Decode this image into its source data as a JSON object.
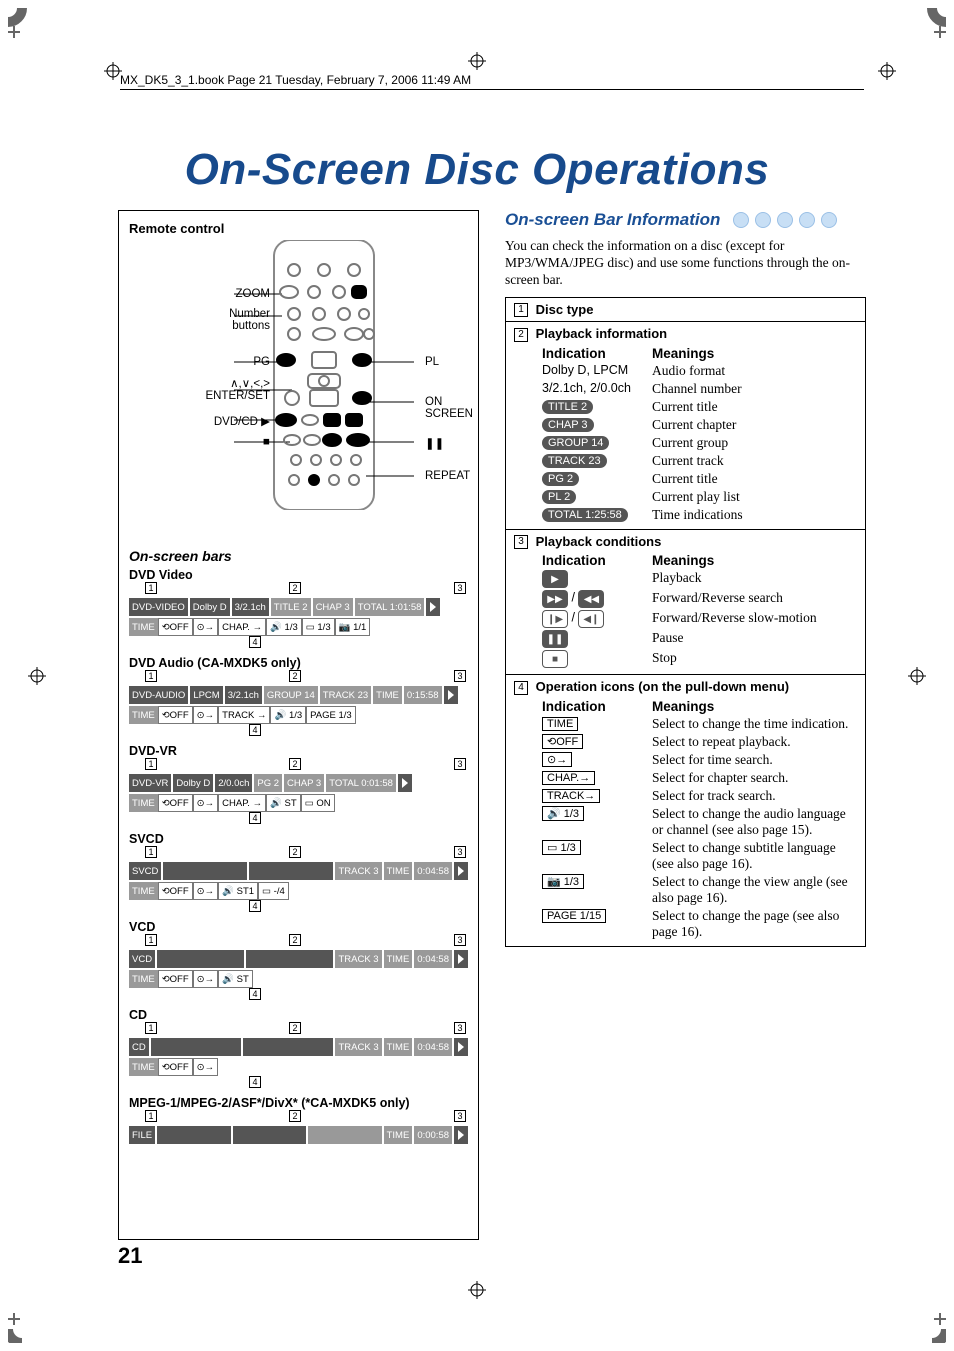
{
  "header_line": "MX_DK5_3_1.book  Page 21  Tuesday, February 7, 2006  11:49 AM",
  "title": "On-Screen Disc Operations",
  "page_number": "21",
  "left": {
    "remote_title": "Remote control",
    "labels": {
      "zoom": "ZOOM",
      "number_buttons_a": "Number",
      "number_buttons_b": "buttons",
      "pg": "PG",
      "arrows_enter": "∧,∨,<,>\nENTER/SET",
      "dvdcd": "DVD/CD ▶",
      "stop": "■",
      "pl": "PL",
      "onscreen": "ON SCREEN",
      "pause": "❚❚",
      "repeat": "REPEAT"
    },
    "bars_heading": "On-screen bars",
    "bars": [
      {
        "name": "DVD Video",
        "row1": [
          "DVD-VIDEO",
          "Dolby D",
          "3/2.1ch",
          "TITLE 2",
          "CHAP 3",
          "TOTAL 1:01:58",
          "▶"
        ],
        "row2": [
          "TIME",
          "⟲OFF",
          "⊙→",
          "CHAP. →",
          "🔊 1/3",
          "▭ 1/3",
          "📷 1/1"
        ]
      },
      {
        "name": "DVD Audio (CA-MXDK5 only)",
        "row1": [
          "DVD-AUDIO",
          "LPCM",
          "3/2.1ch",
          "GROUP 14",
          "TRACK 23",
          "TIME",
          "0:15:58",
          "▶"
        ],
        "row2": [
          "TIME",
          "⟲OFF",
          "⊙→",
          "TRACK →",
          "🔊 1/3",
          "PAGE 1/3"
        ]
      },
      {
        "name": "DVD-VR",
        "row1": [
          "DVD-VR",
          "Dolby D",
          "2/0.0ch",
          "PG 2",
          "CHAP 3",
          "TOTAL 0:01:58",
          "▶"
        ],
        "row2": [
          "TIME",
          "⟲OFF",
          "⊙→",
          "CHAP. →",
          "🔊 ST",
          "▭ ON"
        ]
      },
      {
        "name": "SVCD",
        "row1": [
          "SVCD",
          "",
          "",
          "TRACK 3",
          "TIME",
          "0:04:58",
          "▶"
        ],
        "row2": [
          "TIME",
          "⟲OFF",
          "⊙→",
          "🔊 ST1",
          "▭ -/4"
        ]
      },
      {
        "name": "VCD",
        "row1": [
          "VCD",
          "",
          "",
          "TRACK 3",
          "TIME",
          "0:04:58",
          "▶"
        ],
        "row2": [
          "TIME",
          "⟲OFF",
          "⊙→",
          "🔊 ST"
        ]
      },
      {
        "name": "CD",
        "row1": [
          "CD",
          "",
          "",
          "TRACK 3",
          "TIME",
          "0:04:58",
          "▶"
        ],
        "row2": [
          "TIME",
          "⟲OFF",
          "⊙→"
        ]
      },
      {
        "name": "MPEG-1/MPEG-2/ASF*/DivX* (*CA-MXDK5 only)",
        "row1": [
          "FILE",
          "",
          "",
          "",
          "TIME",
          "0:00:58",
          "▶"
        ],
        "row2": []
      }
    ]
  },
  "right": {
    "heading": "On-screen Bar Information",
    "intro": "You can check the information on a disc (except for MP3/WMA/JPEG disc) and use some functions through the on-screen bar.",
    "s1": {
      "title": "Disc type"
    },
    "s2": {
      "title": "Playback information",
      "head_ind": "Indication",
      "head_mean": "Meanings",
      "rows": [
        {
          "ind": "Dolby D, LPCM",
          "mean": "Audio format",
          "style": "plain"
        },
        {
          "ind": "3/2.1ch, 2/0.0ch",
          "mean": "Channel number",
          "style": "plain"
        },
        {
          "ind": "TITLE 2",
          "mean": "Current title",
          "style": "pill"
        },
        {
          "ind": "CHAP 3",
          "mean": "Current chapter",
          "style": "pill"
        },
        {
          "ind": "GROUP 14",
          "mean": "Current group",
          "style": "pill"
        },
        {
          "ind": "TRACK 23",
          "mean": "Current track",
          "style": "pill"
        },
        {
          "ind": "PG   2",
          "mean": "Current title",
          "style": "pill"
        },
        {
          "ind": "PL   2",
          "mean": "Current play list",
          "style": "pill"
        },
        {
          "ind": "TOTAL 1:25:58",
          "mean": "Time indications",
          "style": "pill"
        }
      ]
    },
    "s3": {
      "title": "Playback conditions",
      "head_ind": "Indication",
      "head_mean": "Meanings",
      "rows": [
        {
          "icon": "play",
          "mean": "Playback"
        },
        {
          "icon": "ffrw",
          "mean": "Forward/Reverse search"
        },
        {
          "icon": "slow",
          "mean": "Forward/Reverse slow-motion"
        },
        {
          "icon": "pause",
          "mean": "Pause"
        },
        {
          "icon": "stop",
          "mean": "Stop"
        }
      ]
    },
    "s4": {
      "title": "Operation icons (on the pull-down menu)",
      "head_ind": "Indication",
      "head_mean": "Meanings",
      "rows": [
        {
          "box": "TIME",
          "mean": "Select to change the time indication."
        },
        {
          "box": "⟲OFF",
          "mean": "Select to repeat playback."
        },
        {
          "box": "⊙→",
          "mean": "Select for time search."
        },
        {
          "box": "CHAP.→",
          "mean": "Select for chapter search."
        },
        {
          "box": "TRACK→",
          "mean": "Select for track search."
        },
        {
          "box": "🔊 1/3",
          "mean": "Select to change the audio language or channel (see also page 15)."
        },
        {
          "box": "▭ 1/3",
          "mean": "Select to change subtitle language (see also page 16)."
        },
        {
          "box": "📷 1/3",
          "mean": "Select to change the view angle (see also page 16)."
        },
        {
          "box": "PAGE 1/15",
          "mean": "Select to change the page (see also page 16)."
        }
      ]
    }
  }
}
